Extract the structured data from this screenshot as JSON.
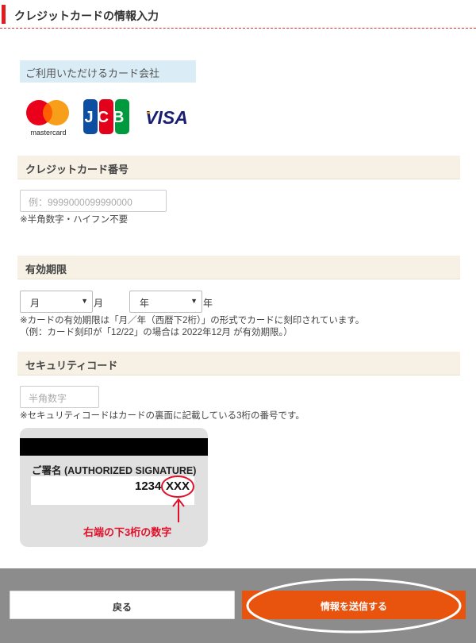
{
  "header": {
    "title": "クレジットカードの情報入力"
  },
  "card_companies": {
    "label": "ご利用いただけるカード会社",
    "brands": [
      {
        "name": "mastercard",
        "icon": "mastercard-logo"
      },
      {
        "name": "JCB",
        "icon": "jcb-logo"
      },
      {
        "name": "VISA",
        "icon": "visa-logo"
      }
    ]
  },
  "card_number": {
    "heading": "クレジットカード番号",
    "placeholder": "例：9999000099990000",
    "note": "※半角数字・ハイフン不要"
  },
  "expiry": {
    "heading": "有効期限",
    "month_select": "月",
    "month_unit": "月",
    "year_select": "年",
    "year_unit": "年",
    "note1": "※カードの有効期限は「月／年（西暦下2桁）」の形式でカードに刻印されています。",
    "note2": "（例：カード刻印が「12/22」の場合は 2022年12月 が有効期限。）"
  },
  "security": {
    "heading": "セキュリティコード",
    "placeholder": "半角数字",
    "note": "※セキュリティコードはカードの裏面に記載している3桁の番号です。",
    "illustration": {
      "signature_label": "ご署名 (AUTHORIZED SIGNATURE)",
      "number": "1234",
      "code": "XXX",
      "caption": "右端の下3桁の数字"
    }
  },
  "footer": {
    "back_label": "戻る",
    "submit_label": "情報を送信する"
  },
  "colors": {
    "accent": "#e01e1e",
    "submit": "#e8530e",
    "section_bg": "#f6f1e4",
    "label_bg": "#daedf7",
    "footer_bg": "#8c8c8c"
  }
}
